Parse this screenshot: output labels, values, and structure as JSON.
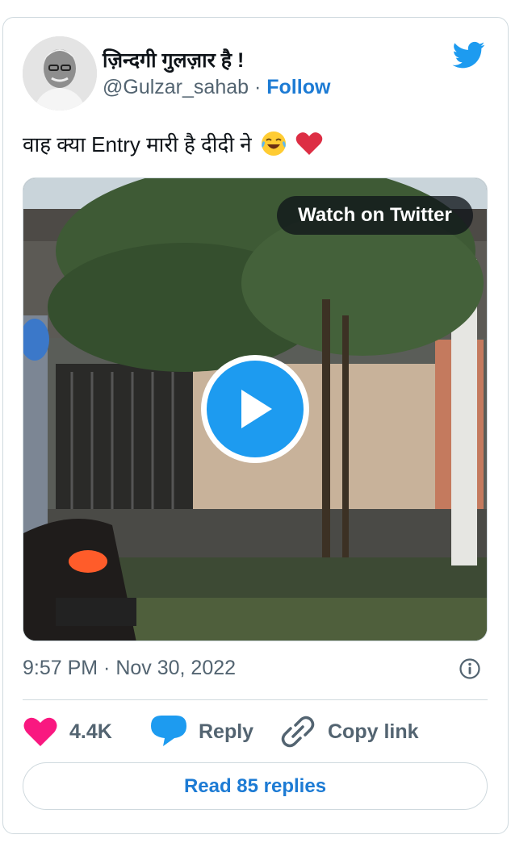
{
  "author": {
    "display_name": "ज़िन्दगी गुलज़ार है !",
    "handle": "@Gulzar_sahab",
    "separator": "·",
    "follow_label": "Follow"
  },
  "tweet": {
    "text": "वाह क्या Entry मारी है दीदी ने",
    "emojis": [
      "face-with-tears-of-joy-icon",
      "red-heart-icon"
    ],
    "timestamp": "9:57 PM · Nov 30, 2022"
  },
  "media": {
    "watch_label": "Watch on Twitter",
    "play_icon": "play-icon"
  },
  "actions": {
    "like_count": "4.4K",
    "reply_label": "Reply",
    "copy_label": "Copy link"
  },
  "read_replies_label": "Read 85 replies",
  "colors": {
    "accent": "#1d9bf0",
    "link": "#1d7bd4",
    "like": "#f91880",
    "muted": "#536471",
    "border": "#cfd9de"
  }
}
